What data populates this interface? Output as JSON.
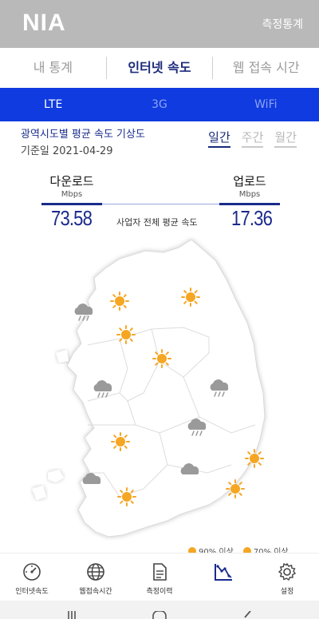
{
  "app": {
    "logo": "NIA",
    "header_action": "측정통계"
  },
  "tabs": [
    {
      "label": "내 통계",
      "active": false
    },
    {
      "label": "인터넷 속도",
      "active": true
    },
    {
      "label": "웹 접속 시간",
      "active": false
    }
  ],
  "network_tabs": [
    {
      "label": "LTE",
      "active": true
    },
    {
      "label": "3G",
      "active": false
    },
    {
      "label": "WiFi",
      "active": false
    }
  ],
  "forecast": {
    "title": "광역시도별 평균 속도 기상도",
    "base_date": "기준일 2021-04-29",
    "periods": [
      {
        "label": "일간",
        "active": true
      },
      {
        "label": "주간",
        "active": false
      },
      {
        "label": "월간",
        "active": false
      }
    ]
  },
  "speed": {
    "download_label": "다운로드",
    "download_unit": "Mbps",
    "download_value": "73.58",
    "upload_label": "업로드",
    "upload_unit": "Mbps",
    "upload_value": "17.36",
    "caption": "사업자 전체 평균 속도"
  },
  "map_icons": [
    "sun-icon",
    "cloud-rain-icon",
    "cloud-icon"
  ],
  "legend": [
    {
      "label": "90% 이상"
    },
    {
      "label": "70% 이상"
    }
  ],
  "bottom_nav": [
    {
      "label": "인터넷속도",
      "icon": "speedometer-icon",
      "active": false
    },
    {
      "label": "웹접속시간",
      "icon": "globe-icon",
      "active": false
    },
    {
      "label": "측정이력",
      "icon": "document-icon",
      "active": false
    },
    {
      "label": "",
      "icon": "chart-icon",
      "active": true
    },
    {
      "label": "설정",
      "icon": "gear-icon",
      "active": false
    }
  ],
  "colors": {
    "appbar": "#b9b9b9",
    "accent_blue": "#0f3be0",
    "navy": "#1a2a8c",
    "sun": "#f5a623",
    "cloud": "#9a9a9a"
  }
}
